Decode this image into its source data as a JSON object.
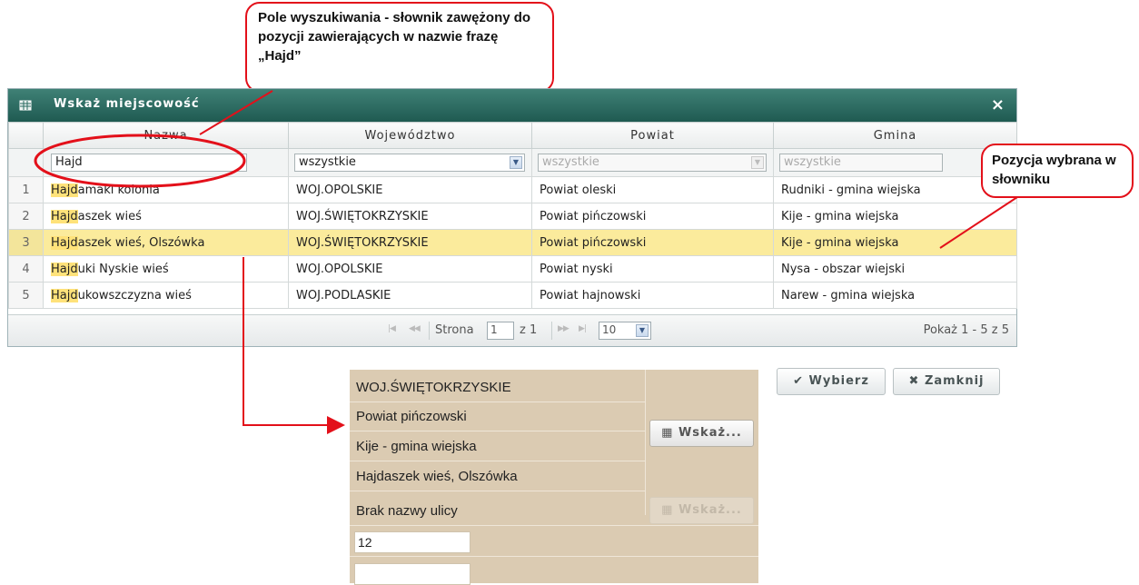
{
  "dialog": {
    "title": "Wskaż miejscowość",
    "close_glyph": "×",
    "columns": [
      "Nazwa",
      "Województwo",
      "Powiat",
      "Gmina"
    ],
    "filters": {
      "nazwa": "Hajd",
      "wojewodztwo": "wszystkie",
      "powiat": "wszystkie",
      "gmina": "wszystkie"
    },
    "rows": [
      {
        "num": "1",
        "match": "Hajd",
        "rest": "amaki kolonia",
        "woj": "WOJ.OPOLSKIE",
        "powiat": "Powiat oleski",
        "gmina": "Rudniki - gmina wiejska"
      },
      {
        "num": "2",
        "match": "Hajd",
        "rest": "aszek wieś",
        "woj": "WOJ.ŚWIĘTOKRZYSKIE",
        "powiat": "Powiat pińczowski",
        "gmina": "Kije - gmina wiejska"
      },
      {
        "num": "3",
        "match": "Hajd",
        "rest": "aszek wieś, Olszówka",
        "woj": "WOJ.ŚWIĘTOKRZYSKIE",
        "powiat": "Powiat pińczowski",
        "gmina": "Kije - gmina wiejska"
      },
      {
        "num": "4",
        "match": "Hajd",
        "rest": "uki Nyskie wieś",
        "woj": "WOJ.OPOLSKIE",
        "powiat": "Powiat nyski",
        "gmina": "Nysa - obszar wiejski"
      },
      {
        "num": "5",
        "match": "Hajd",
        "rest": "ukowszczyzna wieś",
        "woj": "WOJ.PODLASKIE",
        "powiat": "Powiat hajnowski",
        "gmina": "Narew - gmina wiejska"
      }
    ],
    "selected_row": "3",
    "pager": {
      "page_label": "Strona",
      "page": "1",
      "of_label": "z 1",
      "page_size": "10",
      "summary": "Pokaż 1 - 5 z 5"
    }
  },
  "callouts": {
    "search": "Pole wyszukiwania - słownik zawężony do pozycji zawierających w nazwie frazę  „Hajd”",
    "selected": "Pozycja wybrana w słowniku"
  },
  "buttons": {
    "select": "Wybierz",
    "close": "Zamknij"
  },
  "form": {
    "wojewodztwo": "WOJ.ŚWIĘTOKRZYSKIE",
    "powiat": "Powiat pińczowski",
    "gmina": "Kije - gmina wiejska",
    "miejscowosc": "Hajdaszek wieś, Olszówka",
    "ulica": "Brak nazwy ulicy",
    "nr_domu": "12",
    "nr_lokalu": "",
    "wskaz_label": "Wskaż...",
    "wskaz_disabled_label": "Wskaż..."
  },
  "colors": {
    "accent": "#e3101a",
    "titlebar": "#2b6b61",
    "selected_row": "#fbeb9c",
    "panel": "#dbcbb2"
  }
}
